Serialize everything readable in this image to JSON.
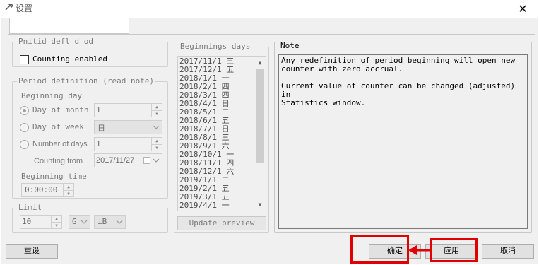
{
  "window": {
    "title": "设置",
    "close_glyph": "✕"
  },
  "tabs": {
    "active_label": ""
  },
  "period_definition": {
    "legend": "Pnitid defl d od",
    "counting_enabled_label": "Counting enabled"
  },
  "period_settings": {
    "legend": "Period definition (read note)",
    "beginning_day_label": "Beginning day",
    "day_of_month_label": "Day of month",
    "day_of_month_value": "1",
    "day_of_week_label": "Day of week",
    "day_of_week_value": "日",
    "number_of_days_label": "Number of days",
    "number_of_days_value": "1",
    "counting_from_label": "Counting from",
    "counting_from_value": "2017/11/27",
    "beginning_time_label": "Beginning time",
    "beginning_time_value": "0:00:00"
  },
  "limit": {
    "legend": "Limit",
    "value": "10",
    "unit_prefix": "G",
    "unit_suffix": "iB"
  },
  "beginnings": {
    "legend": "Beginnings days",
    "items": [
      "2017/11/1 三",
      "2017/12/1 五",
      "2018/1/1 一",
      "2018/2/1 四",
      "2018/3/1 四",
      "2018/4/1 日",
      "2018/5/1 二",
      "2018/6/1 五",
      "2018/7/1 日",
      "2018/8/1 三",
      "2018/9/1 六",
      "2018/10/1 一",
      "2018/11/1 四",
      "2018/12/1 六",
      "2019/1/1 二",
      "2019/2/1 五",
      "2019/3/1 五",
      "2019/4/1 一"
    ],
    "update_button": "Update preview"
  },
  "note": {
    "legend": "Note",
    "line1": "Any redefinition of period beginning will open new",
    "line2": "counter with zero accrual.",
    "line3": "Current value of counter can be changed (adjusted) in",
    "line4": "Statistics window."
  },
  "footer": {
    "reset_button": "重设",
    "ok_button": "确定",
    "apply_button": "应用",
    "cancel_button": "取消"
  },
  "annotation_color": "#e10000"
}
